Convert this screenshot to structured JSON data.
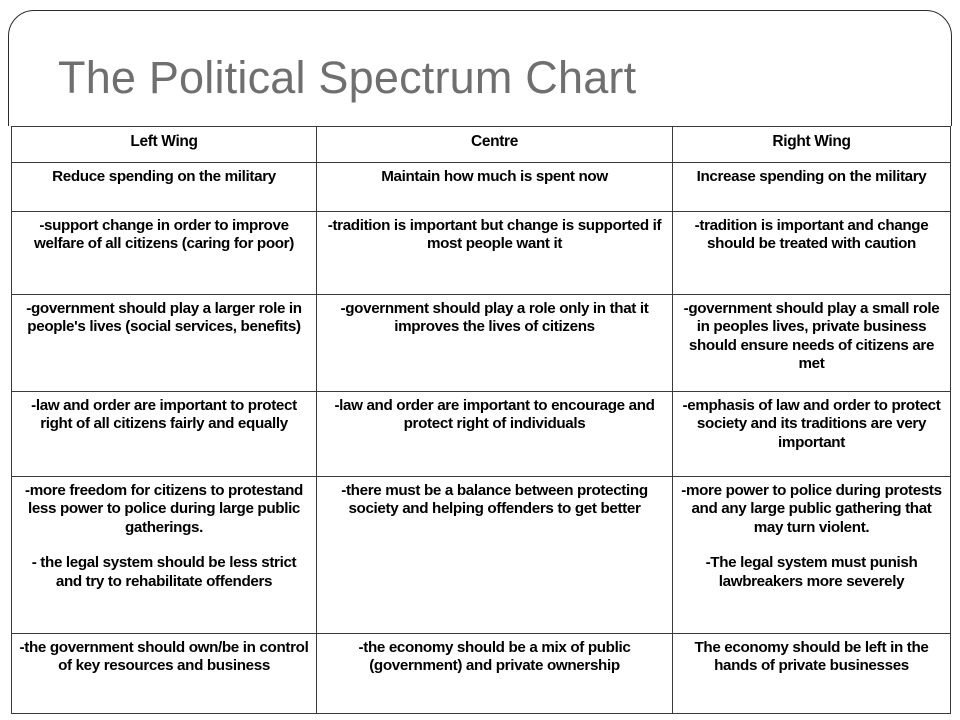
{
  "slide": {
    "title": "The Political Spectrum Chart",
    "title_color": "#6f6f6f",
    "border_color": "#2b2b2b",
    "text_color": "#000000"
  },
  "table": {
    "headers": [
      "Left Wing",
      "Centre",
      "Right Wing"
    ],
    "rows": [
      {
        "id": "military-spending",
        "cells": [
          {
            "paragraphs": [
              "Reduce spending on the military"
            ]
          },
          {
            "paragraphs": [
              "Maintain how much is spent now"
            ]
          },
          {
            "paragraphs": [
              "Increase spending on the military"
            ]
          }
        ]
      },
      {
        "id": "tradition-and-change",
        "cells": [
          {
            "paragraphs": [
              "-support change in order to improve welfare of all citizens (caring for poor)"
            ]
          },
          {
            "paragraphs": [
              "-tradition is important but change is supported if most people want it"
            ]
          },
          {
            "paragraphs": [
              "-tradition is important and change should be treated with caution"
            ]
          }
        ]
      },
      {
        "id": "role-of-government",
        "cells": [
          {
            "paragraphs": [
              "-government should play a larger role in people's lives (social services, benefits)"
            ]
          },
          {
            "paragraphs": [
              "-government should play a role only in that it improves the lives of citizens"
            ]
          },
          {
            "paragraphs": [
              "-government should play a small role in peoples lives, private business should ensure needs of citizens are met"
            ]
          }
        ]
      },
      {
        "id": "law-and-order",
        "cells": [
          {
            "paragraphs": [
              "-law and order are important to protect right of all citizens fairly and equally"
            ]
          },
          {
            "paragraphs": [
              "-law and order are important to encourage and protect right of individuals"
            ]
          },
          {
            "paragraphs": [
              "-emphasis of law and order to protect society and its traditions are very important"
            ]
          }
        ]
      },
      {
        "id": "freedom-and-justice",
        "cells": [
          {
            "paragraphs": [
              "-more freedom for citizens to protestand less power to police during large public gatherings.",
              "- the legal system should be less strict and try to rehabilitate offenders"
            ]
          },
          {
            "paragraphs": [
              "-there must be a balance between protecting society and helping offenders to get better"
            ]
          },
          {
            "paragraphs": [
              "-more power to police during protests and any large public gathering that may turn violent.",
              "-The legal system must punish lawbreakers more severely"
            ]
          }
        ]
      },
      {
        "id": "economy-ownership",
        "cells": [
          {
            "paragraphs": [
              "-the government should own/be in control of  key resources and business"
            ]
          },
          {
            "paragraphs": [
              "-the economy should be a mix of public (government) and private ownership"
            ]
          },
          {
            "paragraphs": [
              "The economy should be left in the hands of private businesses"
            ]
          }
        ]
      }
    ]
  }
}
